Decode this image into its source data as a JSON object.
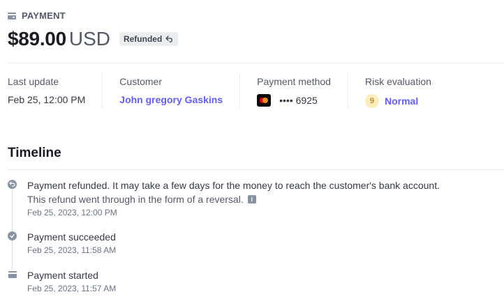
{
  "header": {
    "label": "PAYMENT",
    "amount": "$89.00",
    "currency": "USD",
    "status_badge": "Refunded"
  },
  "meta": {
    "last_update": {
      "label": "Last update",
      "value": "Feb 25, 12:00 PM"
    },
    "customer": {
      "label": "Customer",
      "value": "John gregory Gaskins"
    },
    "payment_method": {
      "label": "Payment method",
      "value": "•••• 6925",
      "card_brand": "mastercard"
    },
    "risk": {
      "label": "Risk evaluation",
      "score": "9",
      "value": "Normal"
    }
  },
  "timeline": {
    "title": "Timeline",
    "events": [
      {
        "text": "Payment refunded. It may take a few days for the money to reach the customer's bank account.",
        "subtext": "This refund went through in the form of a reversal.",
        "time": "Feb 25, 2023, 12:00 PM",
        "icon": "refund-icon"
      },
      {
        "text": "Payment succeeded",
        "time": "Feb 25, 2023, 11:58 AM",
        "icon": "check-icon"
      },
      {
        "text": "Payment started",
        "time": "Feb 25, 2023, 11:57 AM",
        "icon": "payment-icon"
      }
    ]
  },
  "colors": {
    "link": "#635bff",
    "muted": "#545969",
    "border": "#ebeef1",
    "risk_badge": "#fcedb9"
  }
}
